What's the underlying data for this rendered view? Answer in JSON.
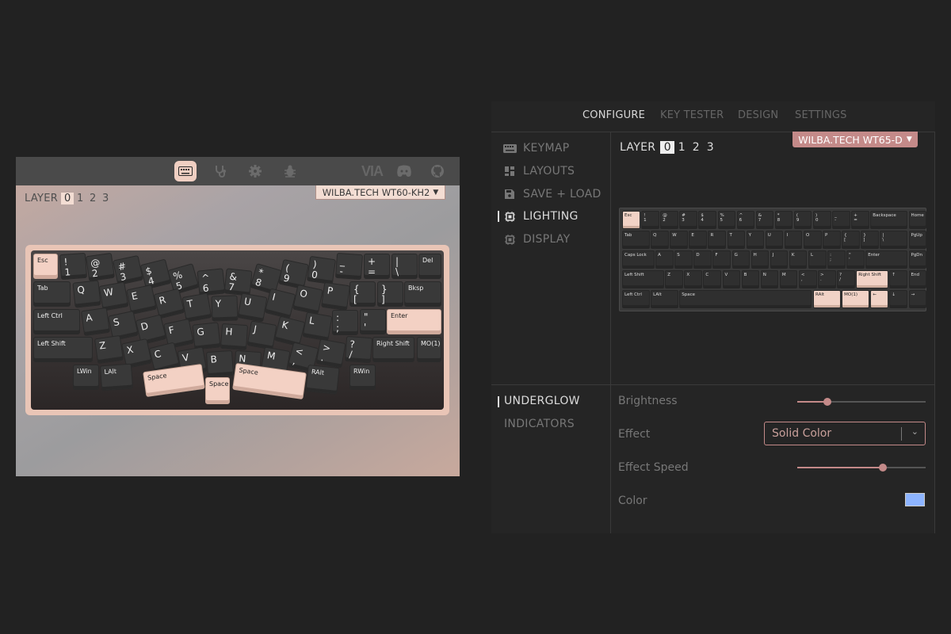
{
  "left_app": {
    "toolbar": {
      "icons": [
        "keyboard-icon",
        "stethoscope-icon",
        "gear-icon",
        "bug-icon",
        "via-logo",
        "discord-icon",
        "github-icon"
      ],
      "logo_text": "VIA"
    },
    "layer": {
      "label": "LAYER",
      "options": [
        "0",
        "1",
        "2",
        "3"
      ],
      "selected": "0"
    },
    "keyboard_select": {
      "value": "WILBA.TECH WT60-KH2"
    },
    "keys": [
      "Esc",
      "!\n1",
      "@\n2",
      "#\n3",
      "$\n4",
      "%\n5",
      "^\n6",
      "&\n7",
      "*\n8",
      "(\n9",
      ")\n0",
      "_\n-",
      "+\n=",
      "|\n\\",
      "Del",
      "Tab",
      "Q",
      "W",
      "E",
      "R",
      "T",
      "Y",
      "U",
      "I",
      "O",
      "P",
      "{\n[",
      "}\n]",
      "Bksp",
      "Left Ctrl",
      "A",
      "S",
      "D",
      "F",
      "G",
      "H",
      "J",
      "K",
      "L",
      ":\n;",
      "\"\n'",
      "Enter",
      "Left Shift",
      "Z",
      "X",
      "C",
      "V",
      "B",
      "N",
      "M",
      "<\n,",
      ">\n.",
      "?\n/",
      "Right Shift",
      "MO(1)",
      "LWin",
      "LAlt",
      "Space",
      "Space",
      "Space",
      "RAlt",
      "RWin"
    ]
  },
  "right_app": {
    "tabs": [
      "CONFIGURE",
      "KEY TESTER",
      "DESIGN",
      "SETTINGS"
    ],
    "active_tab": "CONFIGURE",
    "sidebar": [
      {
        "label": "KEYMAP",
        "icon": "keyboard-icon"
      },
      {
        "label": "LAYOUTS",
        "icon": "layouts-icon"
      },
      {
        "label": "SAVE + LOAD",
        "icon": "save-icon"
      },
      {
        "label": "LIGHTING",
        "icon": "chip-icon"
      },
      {
        "label": "DISPLAY",
        "icon": "chip-icon"
      }
    ],
    "active_sidebar": "LIGHTING",
    "layer": {
      "label": "LAYER",
      "options": [
        "0",
        "1",
        "2",
        "3"
      ],
      "selected": "0"
    },
    "keyboard_select": {
      "value": "WILBA.TECH WT65-D"
    },
    "keys": [
      "Esc",
      "!\n1",
      "@\n2",
      "#\n3",
      "$\n4",
      "%\n5",
      "^\n6",
      "&\n7",
      "*\n8",
      "(\n9",
      ")\n0",
      "_\n-",
      "+\n=",
      "Backspace",
      "Home",
      "Tab",
      "Q",
      "W",
      "E",
      "R",
      "T",
      "Y",
      "U",
      "I",
      "O",
      "P",
      "{\n[",
      "}\n]",
      "|\n\\",
      "PgUp",
      "Caps Lock",
      "A",
      "S",
      "D",
      "F",
      "G",
      "H",
      "J",
      "K",
      "L",
      ":\n;",
      "\"\n'",
      "Enter",
      "PgDn",
      "Left Shift",
      "Z",
      "X",
      "C",
      "V",
      "B",
      "N",
      "M",
      "<\n,",
      ">\n.",
      "?\n/",
      "Right Shift",
      "↑",
      "End",
      "Left Ctrl",
      "LAlt",
      "Space",
      "RAlt",
      "MO(1)",
      "←",
      "↓",
      "→"
    ],
    "lighting_menu": [
      "UNDERGLOW",
      "INDICATORS"
    ],
    "active_lighting": "UNDERGLOW",
    "controls": {
      "brightness_label": "Brightness",
      "brightness_value": 0.15,
      "effect_label": "Effect",
      "effect_value": "Solid Color",
      "effect_speed_label": "Effect Speed",
      "effect_speed_value": 0.75,
      "color_label": "Color",
      "color_value": "#8db4ff"
    },
    "accent_color": "#c48a89"
  }
}
